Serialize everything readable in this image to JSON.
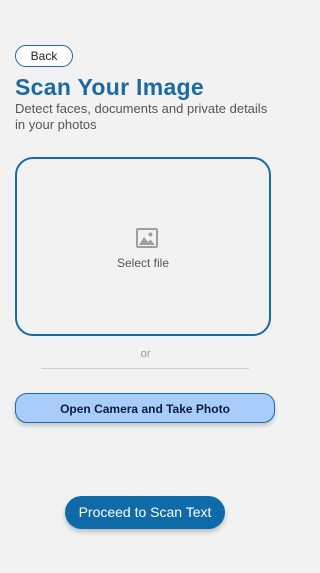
{
  "header": {
    "back_label": "Back",
    "title": "Scan Your Image",
    "subtitle": "Detect faces, documents and private details in your photos"
  },
  "upload": {
    "icon": "image-icon",
    "select_label": "Select file"
  },
  "separator": {
    "label": "or"
  },
  "actions": {
    "camera_label": "Open Camera and Take Photo",
    "proceed_label": "Proceed to Scan Text"
  },
  "colors": {
    "primary": "#1a6aa3",
    "camera_button_bg": "#a8cdfa",
    "proceed_button_bg": "#0f6aa8",
    "background": "#f2f2f2"
  }
}
